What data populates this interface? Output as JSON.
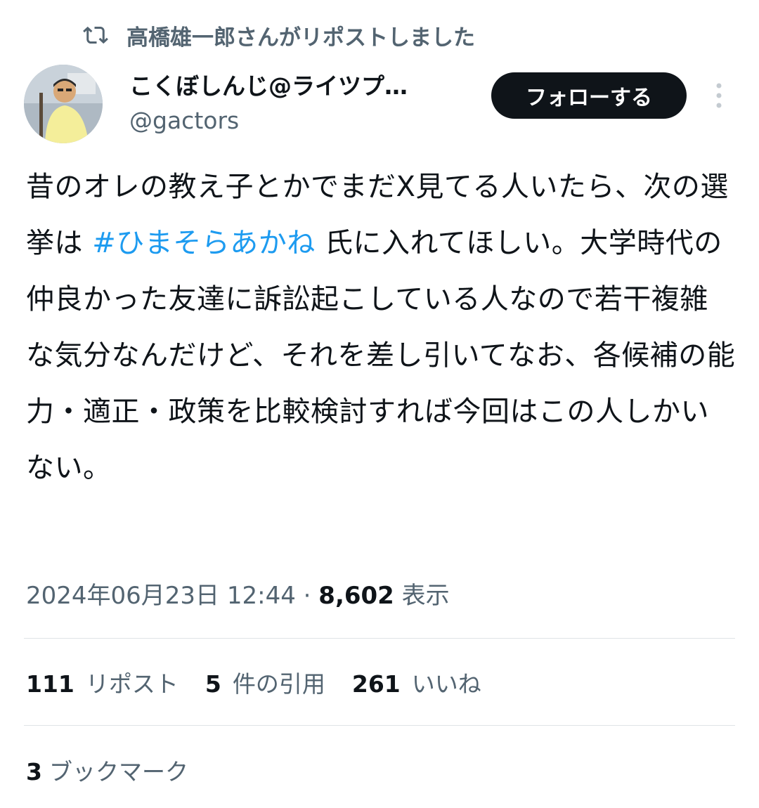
{
  "repost_banner": {
    "text": "高橋雄一郎さんがリポストしました",
    "icon": "repost-icon"
  },
  "author": {
    "display_name": "こくぼしんじ@ライツプ…",
    "handle": "@gactors",
    "avatar": "avatar-photo"
  },
  "follow_button": {
    "label": "フォローする"
  },
  "more_menu": {
    "icon": "more-vertical-icon"
  },
  "tweet": {
    "text_part1": "昔のオレの教え子とかでまだX見てる人いたら、次の選挙は ",
    "hashtag": "#ひまそらあかね",
    "text_part2": " 氏に入れてほしい。大学時代の仲良かった友達に訴訟起こしている人なので若干複雑な気分なんだけど、それを差し引いてなお、各候補の能力・適正・政策を比較検討すれば今回はこの人しかいない。"
  },
  "meta": {
    "timestamp": "2024年06月23日 12:44",
    "separator": " · ",
    "views_count": "8,602",
    "views_label": " 表示"
  },
  "stats": {
    "reposts": {
      "count": "111",
      "label": "リポスト"
    },
    "quotes": {
      "count": "5",
      "label": "件の引用"
    },
    "likes": {
      "count": "261",
      "label": "いいね"
    }
  },
  "bookmarks": {
    "count": "3",
    "label": "ブックマーク"
  },
  "colors": {
    "text_primary": "#0f1419",
    "text_secondary": "#536471",
    "link": "#1d9bf0",
    "button_bg": "#0f1419",
    "divider": "#dfe3e6"
  }
}
